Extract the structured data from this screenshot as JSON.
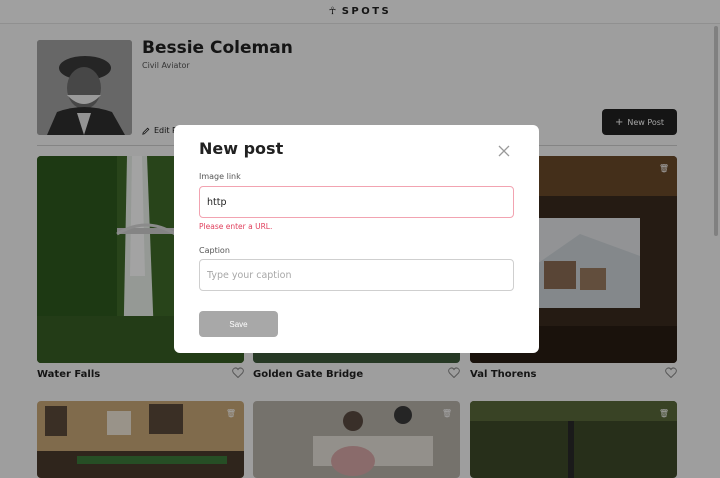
{
  "header": {
    "logo_text": "SPOTS",
    "logo_mark": "☥"
  },
  "profile": {
    "name": "Bessie Coleman",
    "description": "Civil Aviator",
    "edit_label": "Edit Profile",
    "new_post_label": "New Post"
  },
  "cards": [
    {
      "title": "Water Falls"
    },
    {
      "title": "Golden Gate Bridge"
    },
    {
      "title": "Val Thorens"
    },
    {
      "title": ""
    },
    {
      "title": ""
    },
    {
      "title": ""
    }
  ],
  "modal": {
    "title": "New post",
    "image_link_label": "Image link",
    "image_link_value": "http",
    "image_link_error": "Please enter a URL.",
    "caption_label": "Caption",
    "caption_placeholder": "Type your caption",
    "caption_value": "",
    "save_label": "Save"
  },
  "colors": {
    "accent_dark": "#212121",
    "error": "#e0415e",
    "disabled_button": "#a8a8a8"
  },
  "icons": {
    "close": "close-icon",
    "like": "heart-icon",
    "delete": "trash-icon",
    "edit": "pencil-icon",
    "add": "plus-icon"
  }
}
